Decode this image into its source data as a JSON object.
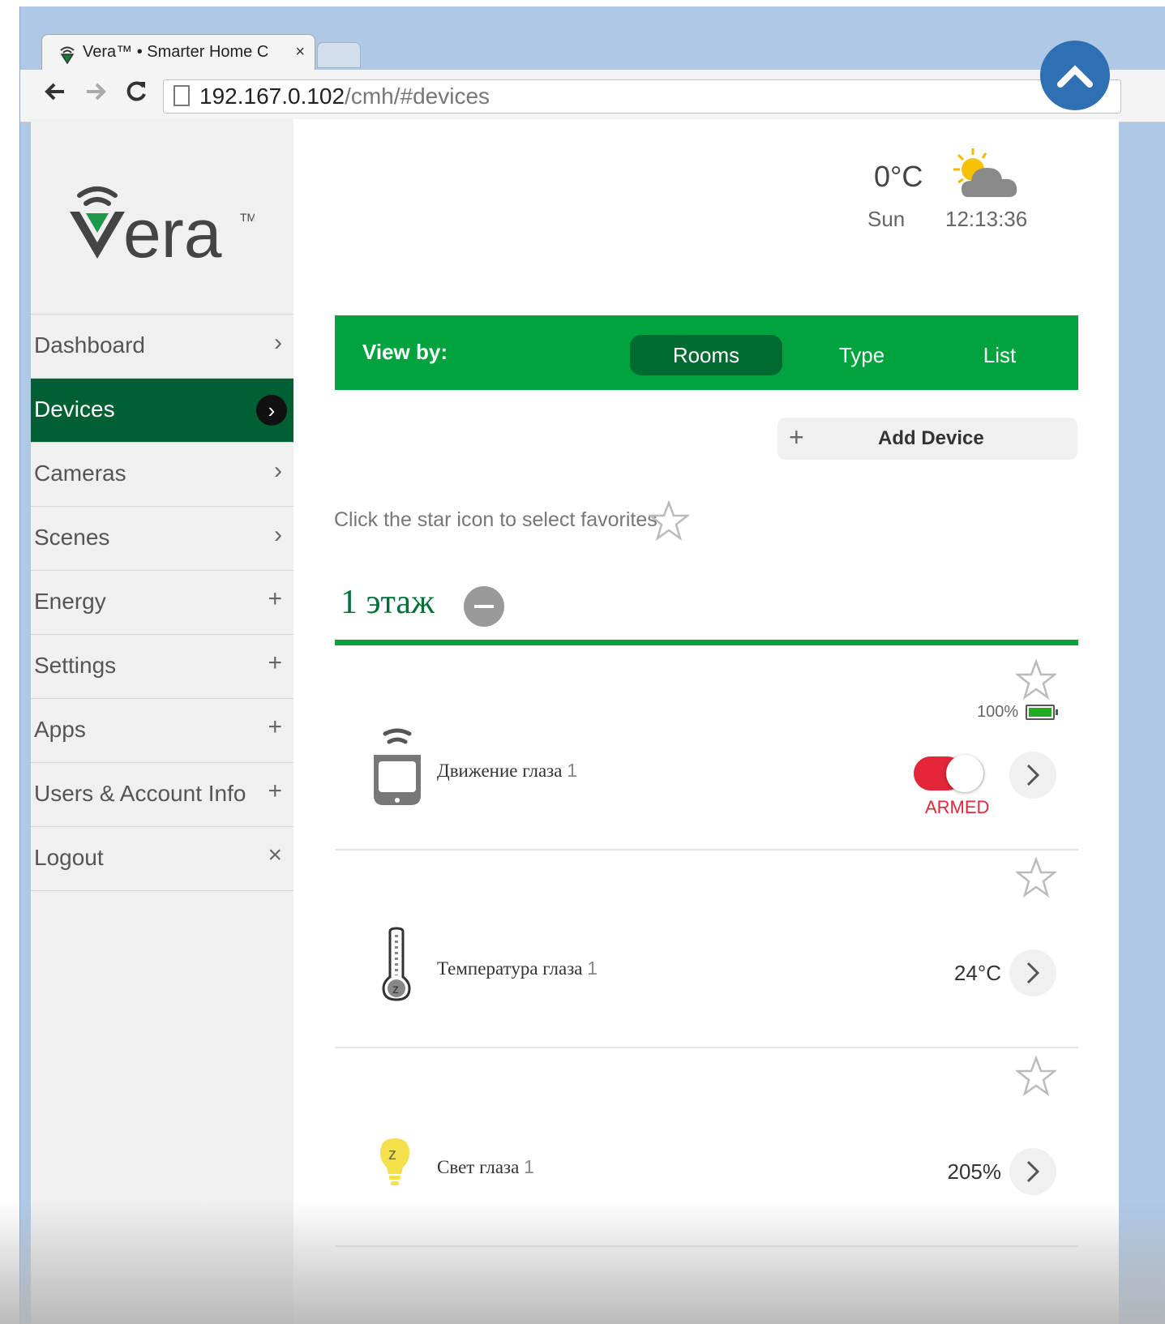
{
  "browser": {
    "tab_title": "Vera™ • Smarter Home C",
    "close_glyph": "×",
    "url_host": "192.167.0.102",
    "url_path": "/cmh/#devices"
  },
  "sidebar": {
    "logo_text": "vera",
    "items": [
      {
        "label": "Dashboard",
        "symbol": "›",
        "active": false
      },
      {
        "label": "Devices",
        "symbol": "›",
        "active": true
      },
      {
        "label": "Cameras",
        "symbol": "›",
        "active": false
      },
      {
        "label": "Scenes",
        "symbol": "›",
        "active": false
      },
      {
        "label": "Energy",
        "symbol": "+",
        "active": false
      },
      {
        "label": "Settings",
        "symbol": "+",
        "active": false
      },
      {
        "label": "Apps",
        "symbol": "+",
        "active": false
      },
      {
        "label": "Users & Account Info",
        "symbol": "+",
        "active": false
      },
      {
        "label": "Logout",
        "symbol": "×",
        "active": false
      }
    ]
  },
  "weather": {
    "temperature": "0°C",
    "day": "Sun",
    "time": "12:13:36",
    "icon": "partly-cloudy-icon"
  },
  "view_by": {
    "label": "View by:",
    "options": [
      "Rooms",
      "Type",
      "List"
    ],
    "selected": "Rooms"
  },
  "add_device": {
    "plus": "+",
    "label": "Add Device"
  },
  "hint": "Click the star icon to select favorites",
  "room": {
    "name": "1 этаж"
  },
  "devices": [
    {
      "name": "Движение глаза",
      "number": "1",
      "icon": "motion-sensor-icon",
      "battery_text": "100%",
      "battery_level": 1.0,
      "armed_label": "ARMED",
      "armed": true
    },
    {
      "name": "Температура глаза",
      "number": "1",
      "icon": "thermometer-icon",
      "value": "24°C"
    },
    {
      "name": "Свет глаза",
      "number": "1",
      "icon": "light-bulb-icon",
      "value": "205%"
    }
  ],
  "colors": {
    "accent_green": "#00a33d",
    "active_menu_green": "#005f33",
    "armed_red": "#e3263a",
    "scroll_button_blue": "#2f6fb3"
  }
}
